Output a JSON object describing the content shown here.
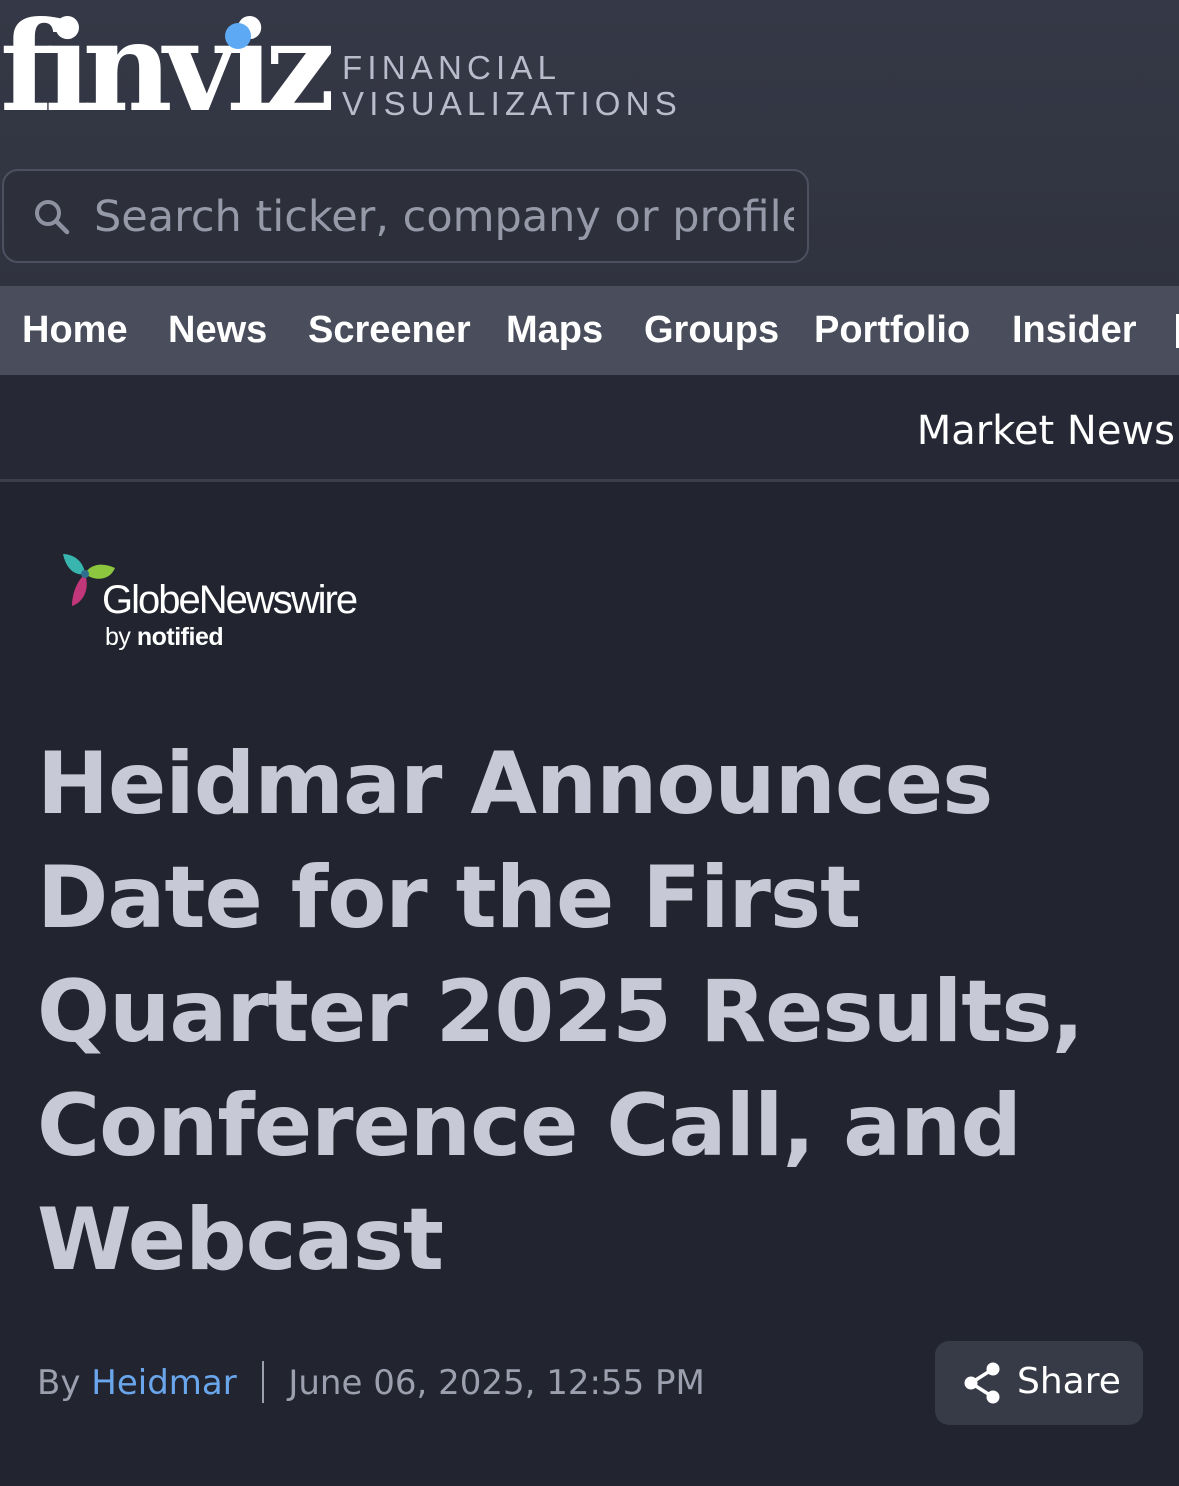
{
  "header": {
    "logo_text": "finviz",
    "tagline_line1": "FINANCIAL",
    "tagline_line2": "VISUALIZATIONS"
  },
  "search": {
    "placeholder": "Search ticker, company or profile",
    "icon": "search-icon"
  },
  "nav": {
    "items": [
      {
        "label": "Home"
      },
      {
        "label": "News"
      },
      {
        "label": "Screener"
      },
      {
        "label": "Maps"
      },
      {
        "label": "Groups"
      },
      {
        "label": "Portfolio"
      },
      {
        "label": "Insider"
      }
    ]
  },
  "subnav": {
    "title": "Market News"
  },
  "source": {
    "name": "GlobeNewswire",
    "by_prefix": "by",
    "by_brand": "notified"
  },
  "article": {
    "headline": "Heidmar Announces Date for the First Quarter 2025 Results, Conference Call, and Webcast",
    "by_label": "By",
    "author": "Heidmar",
    "datetime": "June 06, 2025, 12:55 PM",
    "share_label": "Share"
  },
  "colors": {
    "background": "#22252f",
    "header": "#353846",
    "nav": "#4a4e5c",
    "accent": "#5ea9f4",
    "author_link": "#6aa6ec",
    "headline": "#c8c9d6"
  }
}
